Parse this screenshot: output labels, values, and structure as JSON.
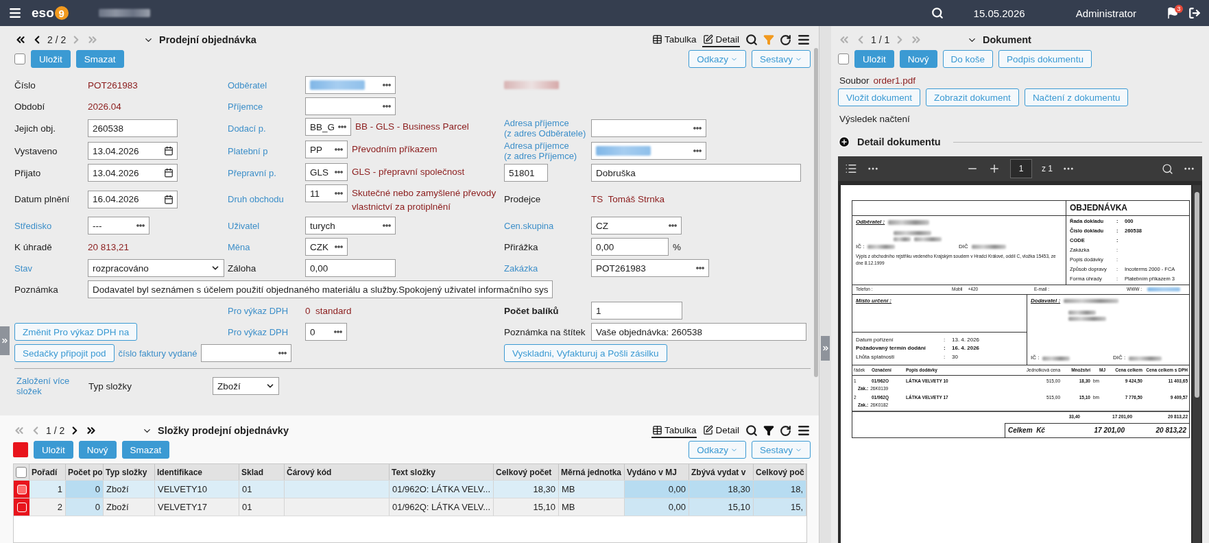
{
  "topbar": {
    "logo_text": "eso",
    "logo_badge": "9",
    "date": "15.05.2026",
    "user": "Administrator",
    "notification_count": "3"
  },
  "order": {
    "nav": {
      "position": "2 / 2",
      "back_enabled": true,
      "forward_enabled": false
    },
    "title": "Prodejní objednávka",
    "views": [
      {
        "label": "Tabulka",
        "selected": false
      },
      {
        "label": "Detail",
        "selected": true
      }
    ],
    "filter_active": true,
    "select_checked": false,
    "buttons": [
      {
        "label": "Uložit",
        "filled": true
      },
      {
        "label": "Smazat",
        "filled": true
      }
    ],
    "menus": [
      "Odkazy",
      "Sestavy"
    ],
    "form_rows": [
      [
        {
          "kind": "label",
          "text": "Číslo"
        },
        {
          "kind": "value",
          "text": "POT261983"
        },
        {
          "kind": "link",
          "text": "Odběratel"
        },
        {
          "kind": "redacted-field"
        },
        {
          "kind": "redacted"
        }
      ],
      [
        {
          "kind": "label",
          "text": "Období"
        },
        {
          "kind": "value",
          "text": "2026.04"
        },
        {
          "kind": "link",
          "text": "Příjemce"
        },
        {
          "kind": "lookup"
        }
      ],
      [
        {
          "kind": "label",
          "text": "Jejich obj."
        },
        {
          "kind": "input",
          "text": "260538"
        },
        {
          "kind": "link",
          "text": "Dodací p."
        },
        {
          "kind": "lookup",
          "text": "BB_G"
        },
        {
          "kind": "note",
          "text": "BB - GLS - Business Parcel"
        },
        {
          "kind": "link",
          "text": "Adresa příjemce\n(z adres Odběratele)"
        },
        {
          "kind": "lookup"
        }
      ],
      [
        {
          "kind": "label",
          "text": "Vystaveno"
        },
        {
          "kind": "date",
          "text": "13.04.2026"
        },
        {
          "kind": "link",
          "text": "Platební p"
        },
        {
          "kind": "lookup",
          "text": "PP"
        },
        {
          "kind": "note",
          "text": "Převodním příkazem"
        },
        {
          "kind": "link",
          "text": "Adresa příjemce\n(z adres Příjemce)"
        },
        {
          "kind": "redacted-field"
        }
      ],
      [
        {
          "kind": "label",
          "text": "Přijato"
        },
        {
          "kind": "date",
          "text": "13.04.2026"
        },
        {
          "kind": "link",
          "text": "Přepravní p."
        },
        {
          "kind": "lookup",
          "text": "GLS"
        },
        {
          "kind": "note",
          "text": "GLS - přepravní společnost"
        },
        {
          "kind": "input",
          "text": "51801"
        },
        {
          "kind": "input",
          "text": "Dobruška"
        }
      ],
      [
        {
          "kind": "label",
          "text": "Datum plnění"
        },
        {
          "kind": "date",
          "text": "16.04.2026"
        },
        {
          "kind": "link",
          "text": "Druh obchodu"
        },
        {
          "kind": "lookup",
          "text": "11"
        },
        {
          "kind": "note",
          "text": "Skutečné nebo zamyšlené převody vlastnictví za protiplnění"
        },
        {
          "kind": "label",
          "text": "Prodejce"
        },
        {
          "kind": "value",
          "text": "TS  Tomáš Strnka"
        }
      ],
      [
        {
          "kind": "link",
          "text": "Středisko"
        },
        {
          "kind": "lookup",
          "text": "---"
        },
        {
          "kind": "link",
          "text": "Uživatel"
        },
        {
          "kind": "lookup",
          "text": "turych"
        },
        {
          "kind": "link",
          "text": "Cen.skupina"
        },
        {
          "kind": "lookup",
          "text": "CZ"
        }
      ],
      [
        {
          "kind": "label",
          "text": "K úhradě"
        },
        {
          "kind": "value",
          "text": "20 813,21"
        },
        {
          "kind": "link",
          "text": "Měna"
        },
        {
          "kind": "lookup",
          "text": "CZK"
        },
        {
          "kind": "label",
          "text": "Přirážka"
        },
        {
          "kind": "input",
          "text": "0,00"
        },
        {
          "kind": "unit",
          "text": "%"
        }
      ],
      [
        {
          "kind": "link",
          "text": "Stav"
        },
        {
          "kind": "select",
          "text": "rozpracováno"
        },
        {
          "kind": "label",
          "text": "Záloha"
        },
        {
          "kind": "input",
          "text": "0,00"
        },
        {
          "kind": "link",
          "text": "Zakázka"
        },
        {
          "kind": "lookup",
          "text": "POT261983"
        }
      ],
      [
        {
          "kind": "label",
          "text": "Poznámka"
        },
        {
          "kind": "input",
          "text": "Dodavatel byl seznámen s účelem použití objednaného materiálu a služby.Spokojený uživatel informačního sys"
        }
      ],
      [
        {
          "kind": "link",
          "text": "Pro výkaz DPH"
        },
        {
          "kind": "value",
          "text": "0  standard"
        },
        {
          "kind": "bold-label",
          "text": "Počet balíků"
        },
        {
          "kind": "input",
          "text": "1"
        }
      ],
      [
        {
          "kind": "button",
          "text": "Změnit Pro výkaz DPH na"
        },
        {
          "kind": "link",
          "text": "Pro výkaz DPH"
        },
        {
          "kind": "lookup",
          "text": "0"
        },
        {
          "kind": "label",
          "text": "Poznámka na štítek"
        },
        {
          "kind": "input",
          "text": "Vaše objednávka: 260538"
        }
      ],
      [
        {
          "kind": "button",
          "text": "Sedačky připojit pod"
        },
        {
          "kind": "link",
          "text": "číslo faktury vydané"
        },
        {
          "kind": "lookup"
        },
        {
          "kind": "button",
          "text": "Vyskladni, Vyfakturuj a Pošli zásilku"
        }
      ]
    ],
    "bulk": {
      "link": "Založení více\nsložek",
      "label": "Typ složky",
      "select": "Zboží"
    }
  },
  "items_panel": {
    "nav": {
      "position": "1 / 2",
      "back_enabled": false,
      "forward_enabled": true
    },
    "title": "Složky prodejní objednávky",
    "views": [
      {
        "label": "Tabulka",
        "selected": true
      },
      {
        "label": "Detail",
        "selected": false
      }
    ],
    "filter_active": false,
    "buttons": [
      {
        "label": "Uložit",
        "filled": true
      },
      {
        "label": "Nový",
        "filled": true
      },
      {
        "label": "Smazat",
        "filled": true
      }
    ],
    "menus": [
      "Odkazy",
      "Sestavy"
    ],
    "table": {
      "select_all_checked": false,
      "columns": [
        {
          "label": "Pořadí",
          "numeric": true,
          "editable": false
        },
        {
          "label": "Počet po",
          "numeric": true,
          "editable": true
        },
        {
          "label": "Typ složky",
          "numeric": false,
          "editable": false
        },
        {
          "label": "Identifikace",
          "numeric": false,
          "editable": false
        },
        {
          "label": "Sklad",
          "numeric": false,
          "editable": false
        },
        {
          "label": "Čárový kód",
          "editable": false
        },
        {
          "label": "Text složky",
          "numeric": false,
          "editable": false
        },
        {
          "label": "Celkový počet",
          "numeric": true,
          "editable": false
        },
        {
          "label": "Měrná jednotka",
          "numeric": false,
          "editable": false
        },
        {
          "label": "Vydáno v MJ",
          "numeric": true,
          "editable": true
        },
        {
          "label": "Zbývá vydat v",
          "numeric": true,
          "editable": true
        },
        {
          "label": "Celkový poč",
          "numeric": true,
          "editable": true
        }
      ],
      "rows": [
        {
          "selected": true,
          "cells": [
            "1",
            "0",
            "Zboží",
            "VELVETY10",
            "01",
            null,
            "01/962O: LÁTKA VELV...",
            "18,30",
            "MB",
            "0,00",
            "18,30",
            "18,"
          ]
        },
        {
          "selected": false,
          "cells": [
            "2",
            "0",
            "Zboží",
            "VELVETY17",
            "01",
            null,
            "01/962Q: LÁTKA VELV...",
            "15,10",
            "MB",
            "0,00",
            "15,10",
            "15,"
          ]
        }
      ]
    }
  },
  "document_panel": {
    "nav": {
      "position": "1 / 1",
      "back_enabled": false,
      "forward_enabled": false
    },
    "title": "Dokument",
    "select_checked": false,
    "buttons": [
      {
        "label": "Uložit",
        "filled": true
      },
      {
        "label": "Nový",
        "filled": true
      },
      {
        "label": "Do koše",
        "filled": false
      },
      {
        "label": "Podpis dokumentu",
        "filled": false
      }
    ],
    "file_label": "Soubor",
    "file_name": "order1.pdf",
    "actions": [
      "Vložit dokument",
      "Zobrazit dokument",
      "Načtení z dokumentu"
    ],
    "result_label": "Výsledek načtení",
    "section_title": "Detail dokumentu",
    "section_expanded": false,
    "viewer": {
      "page": "1",
      "page_count": "z 1"
    },
    "pdf": {
      "title": "OBJEDNÁVKA",
      "customer_label": "Odběratel :",
      "ic_label": "IČ :",
      "dic_label": "DIČ",
      "registry": "Výpis z obchodního rejstříku vedeného Krajským soudem v Hradci Králové, oddíl C, vložka 15453, ze dne 8.12.1999",
      "info": [
        {
          "label": "Řada dokladu",
          "separator": ":",
          "value": "000",
          "bold": true
        },
        {
          "label": "Číslo dokladu",
          "separator": ":",
          "value": "260538",
          "bold": true
        },
        {
          "label": "CODE",
          "separator": ":",
          "bold": true
        },
        {
          "label": "Zakázka",
          "separator": ":",
          "bold": false
        },
        {
          "label": "Popis dodávky",
          "separator": ":",
          "bold": false
        },
        {
          "label": "Způsob dopravy",
          "separator": ":",
          "value": "Incoterms 2000 - FCA",
          "bold": false
        },
        {
          "label": "Forma úhrady",
          "separator": ":",
          "value": "Platebním příkazem 3",
          "bold": false
        }
      ],
      "contacts": [
        {
          "label": "Telefon :"
        },
        {
          "label": "Mobil",
          "value": "+420"
        },
        {
          "label": "E-mail :"
        },
        {
          "label": "WWW :"
        }
      ],
      "destination_label": "Místo určení :",
      "dates": [
        {
          "label": "Datum pořízení",
          "separator": ":",
          "value": "13. 4. 2026",
          "bold": false
        },
        {
          "label": "Požadovaný termín dodání",
          "separator": ":",
          "value": "16. 4. 2026",
          "bold": true
        },
        {
          "label": "Lhůta splatnosti",
          "separator": ":",
          "value": "30",
          "bold": false
        }
      ],
      "supplier_label": "Dodavatel :",
      "supplier_ic_label": "IČ :",
      "supplier_dic_label": "DIČ :",
      "columns": [
        "řádek",
        "Označení",
        "Popis dodávky",
        "Jednotková cena",
        "Množství",
        "MJ",
        "Cena celkem",
        "Cena celkem s DPH"
      ],
      "rows": [
        {
          "cells": [
            "1",
            "01/962O",
            "LÁTKA VELVETY 10",
            "515,00",
            "18,30",
            "bm",
            "9 424,50",
            "11 403,65"
          ],
          "ref_label": "Zak.:",
          "ref": "26K0139"
        },
        {
          "cells": [
            "2",
            "01/962Q",
            "LÁTKA VELVETY 17",
            "515,00",
            "15,10",
            "bm",
            "7 776,50",
            "9 409,57"
          ],
          "ref_label": "Zak.:",
          "ref": "26K0182"
        }
      ],
      "totals": [
        "33,40",
        "17 201,00",
        "20 813,22"
      ],
      "grand_total": {
        "label": "Celkem  Kč",
        "values": [
          "17 201,00",
          "20 813,22"
        ]
      }
    }
  }
}
